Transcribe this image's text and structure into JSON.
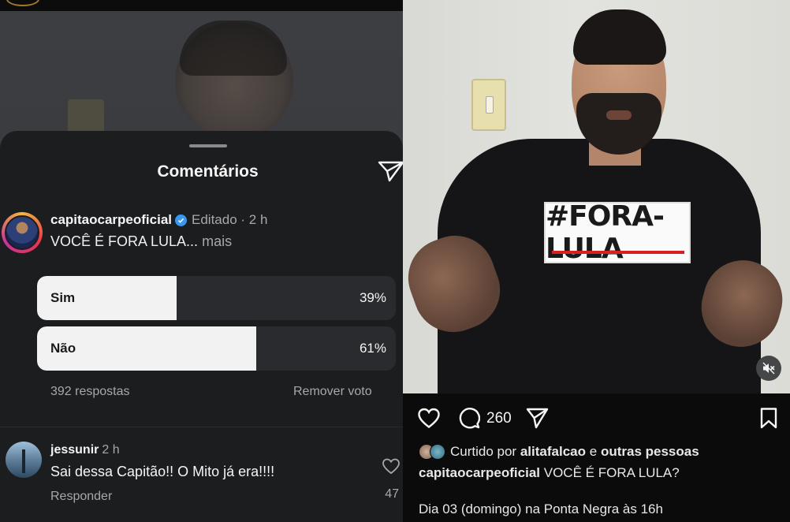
{
  "comments_sheet": {
    "title": "Comentários",
    "post_comment": {
      "username": "capitaocarpeoficial",
      "meta": "Editado · 2 h",
      "text": "VOCÊ É FORA LULA...",
      "more_label": "mais"
    },
    "poll": {
      "options": [
        {
          "label": "Sim",
          "percent_text": "39%",
          "fraction": 0.39
        },
        {
          "label": "Não",
          "percent_text": "61%",
          "fraction": 0.61
        }
      ],
      "responses": "392 respostas",
      "remove_vote": "Remover voto"
    },
    "comment": {
      "username": "jessunir",
      "time": "2 h",
      "text": "Sai dessa Capitão!! O Mito já era!!!!",
      "reply_label": "Responder",
      "likes": "47"
    }
  },
  "post": {
    "shirt_print": "#FORA-LULA",
    "comment_count": "260",
    "liked_prefix": "Curtido por",
    "liked_user": "alitafalcao",
    "liked_join": "e",
    "liked_others": "outras pessoas",
    "caption_user": "capitaocarpeoficial",
    "caption_text": "VOCÊ É FORA LULA?",
    "caption_line2": "Dia 03 (domingo) na Ponta Negra às 16h"
  },
  "colors": {
    "sheet_bg": "#1c1d1f",
    "poll_fill": "#f2f2f2",
    "verified": "#3897f0",
    "muted_text": "#a8a8a8"
  }
}
